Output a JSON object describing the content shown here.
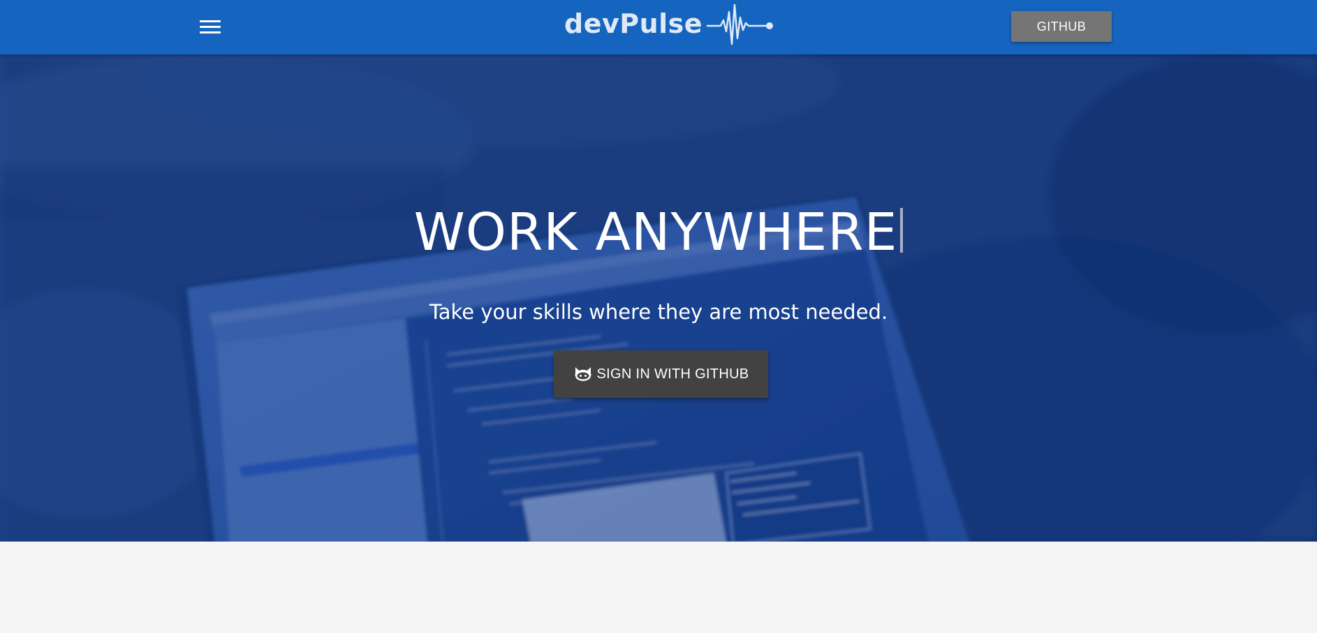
{
  "navbar": {
    "menu_icon": "hamburger-menu-icon",
    "brand_text": "devPulse",
    "brand_icon": "pulse-line-icon",
    "github_label": "GITHUB",
    "background_color": "#1565c0"
  },
  "hero": {
    "title": "WORK ANYWHERE",
    "subtitle": "Take your skills where they are most needed.",
    "signin_label": "SIGN IN WITH GITHUB",
    "signin_icon": "github-octocat-icon",
    "overlay_color": "#1a3f82"
  },
  "colors": {
    "github_button": "#757575",
    "signin_button": "#424242",
    "page_background": "#f5f5f5"
  }
}
